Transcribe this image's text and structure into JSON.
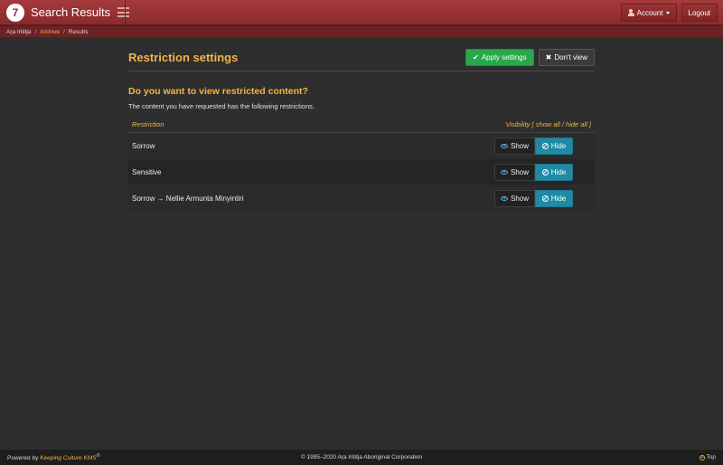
{
  "navbar": {
    "logo_glyph": "7",
    "title": "Search Results",
    "account_label": "Account",
    "logout_label": "Logout"
  },
  "breadcrumb": {
    "items": [
      "Aṟa Irititja",
      "Archive",
      "Results"
    ]
  },
  "main": {
    "title": "Restriction settings",
    "apply_label": "Apply settings",
    "dont_view_label": "Don't view",
    "question": "Do you want to view restricted content?",
    "description": "The content you have requested has the following restrictions.",
    "table": {
      "col_restriction": "Restriction",
      "col_visibility": "Visibility [",
      "show_all": "show all",
      "slash": " / ",
      "hide_all": "hide all",
      "close_bracket": " ]",
      "rows": [
        {
          "label": "Sorrow",
          "show": "Show",
          "hide": "Hide",
          "selected": "hide"
        },
        {
          "label": "Sensitive",
          "show": "Show",
          "hide": "Hide",
          "selected": "hide"
        },
        {
          "label": "Sorrow → Nellie Armunta Minyintiri",
          "show": "Show",
          "hide": "Hide",
          "selected": "hide"
        }
      ]
    }
  },
  "footer": {
    "powered_prefix": "Powered by ",
    "powered_name": "Keeping Culture KMS",
    "powered_mark": "®",
    "copyright": "© 1995–2020 Aṟa Irititja Aboriginal Corporation",
    "top_label": "Top"
  },
  "colors": {
    "navbar": "#9a3335",
    "accent": "#f2b444",
    "apply": "#27a84a",
    "hide_active": "#1f8aa3",
    "background": "#2e2e2e"
  }
}
